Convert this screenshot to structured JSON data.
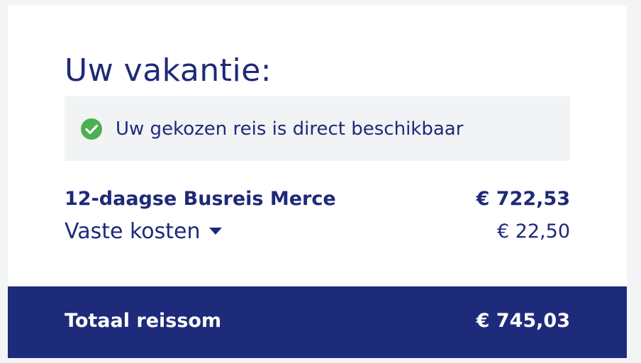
{
  "title": "Uw vakantie:",
  "availability": {
    "icon": "check-circle-icon",
    "text": "Uw gekozen reis is direct beschikbaar",
    "icon_color": "#4caf50"
  },
  "items": [
    {
      "label": "12-daagse Busreis Merce",
      "amount": "€ 722,53"
    },
    {
      "label": "Vaste kosten",
      "amount": "€ 22,50",
      "icon": "caret-down-icon"
    }
  ],
  "total": {
    "label": "Totaal reissom",
    "amount": "€ 745,03"
  },
  "colors": {
    "primary": "#1e2a78",
    "total_background": "#1e2a7a",
    "availability_background": "#f2f3f5"
  }
}
